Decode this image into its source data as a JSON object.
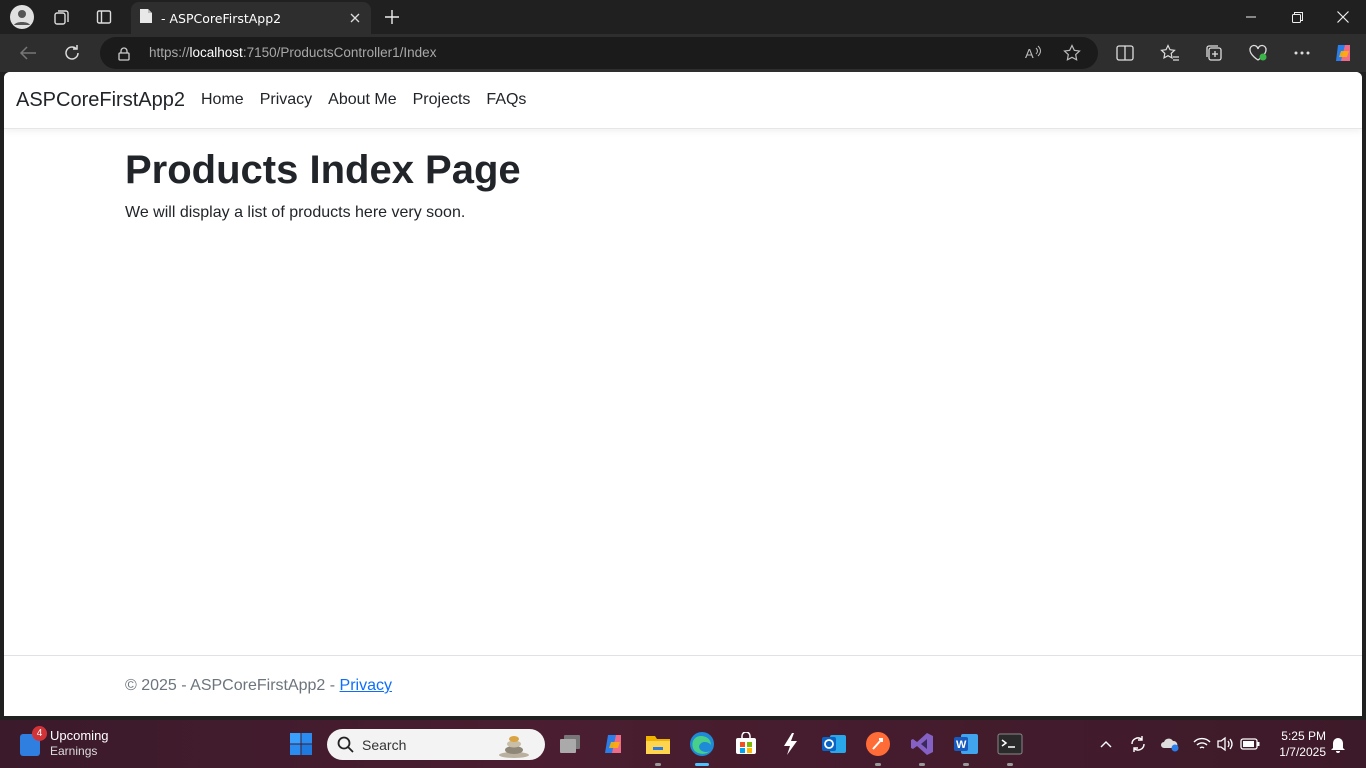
{
  "browser": {
    "tab_title": "- ASPCoreFirstApp2",
    "url_scheme": "https://",
    "url_host": "localhost",
    "url_rest": ":7150/ProductsController1/Index"
  },
  "site": {
    "brand": "ASPCoreFirstApp2",
    "nav": [
      "Home",
      "Privacy",
      "About Me",
      "Projects",
      "FAQs"
    ],
    "heading": "Products Index Page",
    "lead": "We will display a list of products here very soon.",
    "footer_text": "© 2025 - ASPCoreFirstApp2 - ",
    "footer_link": "Privacy"
  },
  "taskbar": {
    "weather_badge": "4",
    "weather_title": "Upcoming",
    "weather_sub": "Earnings",
    "search_placeholder": "Search",
    "time": "5:25 PM",
    "date": "1/7/2025",
    "apps": [
      "start-icon",
      "task-view-icon",
      "copilot-icon",
      "file-explorer-icon",
      "edge-icon",
      "store-icon",
      "visual-studio-code-icon",
      "outlook-icon",
      "postman-icon",
      "visual-studio-icon",
      "word-icon",
      "terminal-icon"
    ]
  },
  "colors": {
    "link": "#0d6efd",
    "footer_text": "#6c757d",
    "edge_active": "#4cc2ff"
  }
}
